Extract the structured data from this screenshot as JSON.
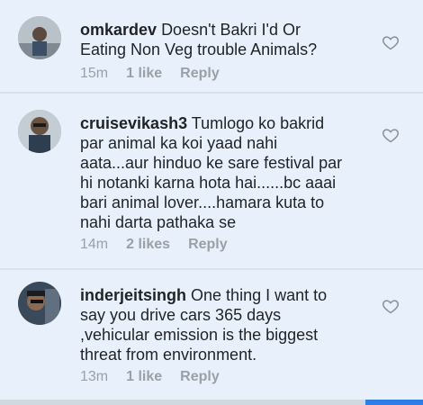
{
  "comments": [
    {
      "username": "omkardev",
      "text": "Doesn't Bakri I'd Or Eating Non Veg trouble Animals?",
      "time": "15m",
      "likes": "1 like",
      "reply": "Reply"
    },
    {
      "username": "cruisevikash3",
      "text": "Tumlogo ko bakrid par animal ka koi yaad nahi aata...aur hinduo ke sare festival par hi notanki karna hota hai......bc aaai bari animal lover....hamara kuta to nahi darta pathaka se",
      "time": "14m",
      "likes": "2 likes",
      "reply": "Reply"
    },
    {
      "username": "inderjeitsingh",
      "text": "One thing I want to say you drive cars 365 days ,vehicular emission is the biggest threat from environment.",
      "time": "13m",
      "likes": "1 like",
      "reply": "Reply"
    }
  ],
  "icons": {
    "like": "heart-outline-icon"
  },
  "colors": {
    "background": "#e8f1fb",
    "text": "#1f2326",
    "meta": "#9aa0a6",
    "accent": "#2f7ee8"
  }
}
